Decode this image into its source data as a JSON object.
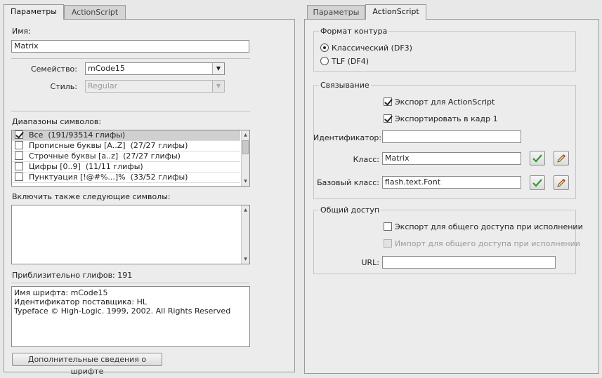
{
  "left": {
    "tabs": [
      {
        "label": "Параметры",
        "active": true
      },
      {
        "label": "ActionScript",
        "active": false
      }
    ],
    "name_label": "Имя:",
    "name_value": "Matrix",
    "family_label": "Семейство:",
    "family_value": "mCode15",
    "style_label": "Стиль:",
    "style_value": "Regular",
    "ranges_label": "Диапазоны символов:",
    "ranges": [
      {
        "label": "Все",
        "count": "(191/93514 глифы)",
        "checked": true
      },
      {
        "label": "Прописные буквы [A..Z]",
        "count": "(27/27 глифы)",
        "checked": false
      },
      {
        "label": "Строчные буквы [a..z]",
        "count": "(27/27 глифы)",
        "checked": false
      },
      {
        "label": "Цифры [0..9]",
        "count": "(11/11 глифы)",
        "checked": false
      },
      {
        "label": "Пунктуация [!@#%...]%",
        "count": "(33/52 глифы)",
        "checked": false
      }
    ],
    "include_label": "Включить также следующие символы:",
    "include_value": "",
    "approx_glyphs": "Приблизительно глифов: 191",
    "font_info": [
      "Имя шрифта: mCode15",
      "Идентификатор поставщика: HL",
      "Typeface © High-Logic. 1999, 2002. All Rights Reserved"
    ],
    "more_info_button": "Дополнительные сведения о шрифте"
  },
  "right": {
    "tabs": [
      {
        "label": "Параметры",
        "active": false
      },
      {
        "label": "ActionScript",
        "active": true
      }
    ],
    "outline_group": "Формат контура",
    "outline_options": [
      {
        "label": "Классический (DF3)",
        "selected": true
      },
      {
        "label": "TLF (DF4)",
        "selected": false
      }
    ],
    "linkage_group": "Связывание",
    "export_as": "Экспорт для ActionScript",
    "export_as_checked": true,
    "export_frame1": "Экспортировать в кадр 1",
    "export_frame1_checked": true,
    "identifier_label": "Идентификатор:",
    "identifier_value": "",
    "class_label": "Класс:",
    "class_value": "Matrix",
    "base_class_label": "Базовый класс:",
    "base_class_value": "flash.text.Font",
    "sharing_group": "Общий доступ",
    "export_runtime": "Экспорт для общего доступа при исполнении",
    "import_runtime": "Импорт для общего доступа при исполнении",
    "url_label": "URL:",
    "url_value": ""
  },
  "colors": {
    "check_green": "#2e9a2e",
    "pencil": "#c0392b"
  }
}
